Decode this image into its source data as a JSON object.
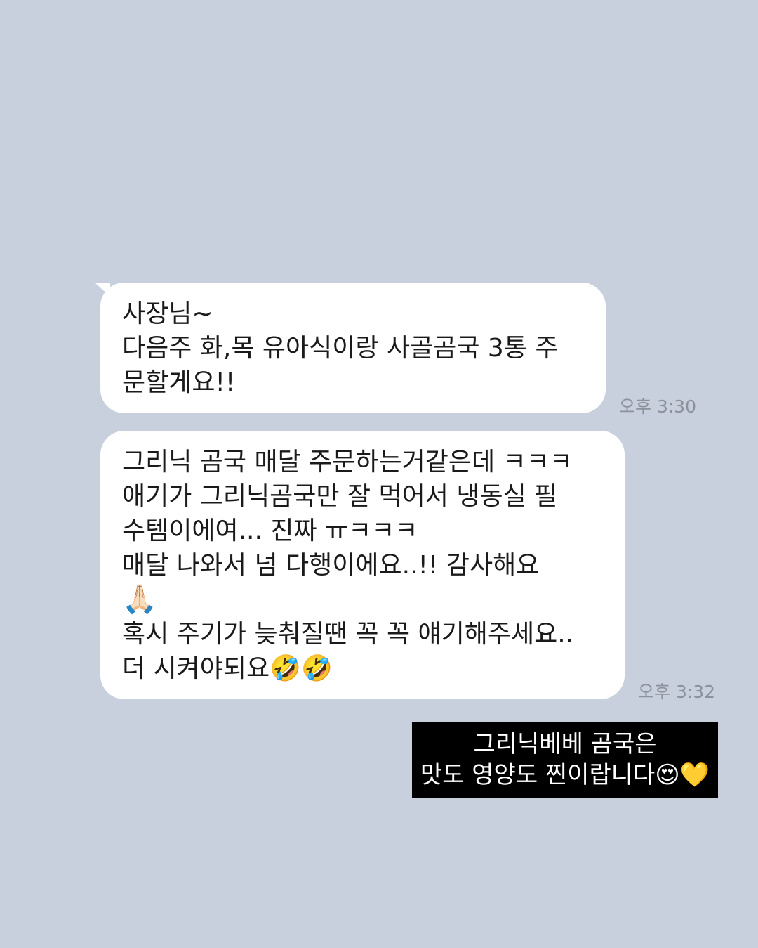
{
  "messages": [
    {
      "lines": [
        "사장님~",
        "다음주 화,목 유아식이랑 사골곰국 3통 주",
        "문할게요!!"
      ],
      "time": "오후 3:30"
    },
    {
      "lines": [
        "그리닉 곰국 매달 주문하는거같은데 ㅋㅋㅋ",
        "애기가 그리닉곰국만 잘 먹어서 냉동실 필",
        "수템이에여... 진짜 ㅠㅋㅋㅋ",
        "매달 나와서 넘 다행이에요..!!  감사해요",
        "🙏🏻",
        "혹시 주기가 늦춰질땐 꼭 꼭 얘기해주세요..",
        " 더 시켜야되요🤣🤣"
      ],
      "time": "오후 3:32"
    }
  ],
  "caption": {
    "lines": [
      "그리닉베베 곰국은",
      "맛도 영양도 찐이랍니다😍💛"
    ]
  },
  "colors": {
    "background": "#c8d0dd",
    "bubble": "#ffffff",
    "timestamp": "#8c929b",
    "caption_background": "#000000",
    "caption_text": "#ffffff"
  }
}
